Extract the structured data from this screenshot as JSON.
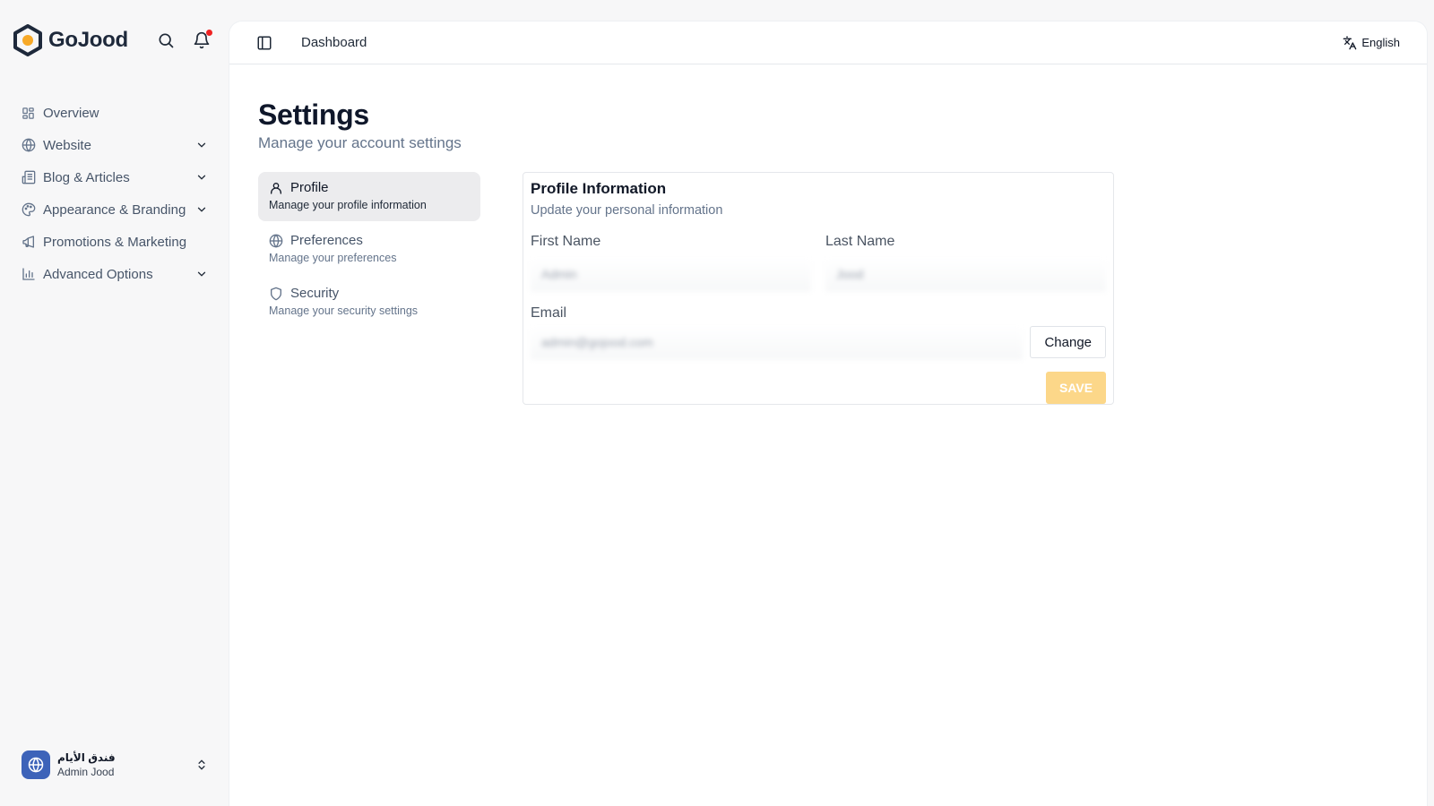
{
  "brand": {
    "name": "GoJood",
    "logo_icon": "hexagon-logo-icon"
  },
  "header_icons": {
    "search": "search-icon",
    "notifications": "bell-icon"
  },
  "sidebar": {
    "items": [
      {
        "label": "Overview",
        "icon": "grid-icon",
        "has_chevron": false
      },
      {
        "label": "Website",
        "icon": "globe-icon",
        "has_chevron": true
      },
      {
        "label": "Blog & Articles",
        "icon": "newspaper-icon",
        "has_chevron": true
      },
      {
        "label": "Appearance & Branding",
        "icon": "palette-icon",
        "has_chevron": true
      },
      {
        "label": "Promotions & Marketing",
        "icon": "megaphone-icon",
        "has_chevron": false
      },
      {
        "label": "Advanced Options",
        "icon": "bar-chart-icon",
        "has_chevron": true
      }
    ],
    "account": {
      "name": "فندق الأيام",
      "role": "Admin Jood"
    }
  },
  "topbar": {
    "breadcrumb": "Dashboard",
    "language": "English"
  },
  "page": {
    "title": "Settings",
    "subtitle": "Manage your account settings"
  },
  "settings_nav": [
    {
      "label": "Profile",
      "description": "Manage your profile information",
      "icon": "user-icon",
      "active": true
    },
    {
      "label": "Preferences",
      "description": "Manage your preferences",
      "icon": "globe-icon",
      "active": false
    },
    {
      "label": "Security",
      "description": "Manage your security settings",
      "icon": "shield-icon",
      "active": false
    }
  ],
  "profile_card": {
    "title": "Profile Information",
    "subtitle": "Update your personal information",
    "first_name_label": "First Name",
    "first_name_value": "Admin",
    "last_name_label": "Last Name",
    "last_name_value": "Jood",
    "email_label": "Email",
    "email_value": "admin@gojood.com",
    "change_label": "Change",
    "save_label": "SAVE"
  },
  "colors": {
    "accent": "#fcd789",
    "notification_dot": "#ef2222",
    "avatar_bg": "#3d63b9",
    "logo_orange": "#f7a928"
  }
}
